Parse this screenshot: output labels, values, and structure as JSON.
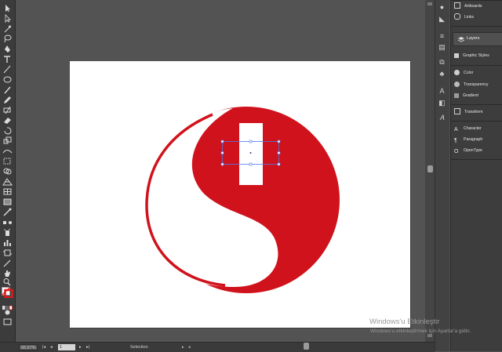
{
  "panels": {
    "items": [
      {
        "label": "Artboards",
        "icon": "artboards-icon"
      },
      {
        "label": "Links",
        "icon": "links-icon"
      },
      {
        "label": "Layers",
        "icon": "layers-icon"
      },
      {
        "label": "Swatches",
        "icon": "swatches-icon"
      },
      {
        "label": "Graphic Styles",
        "icon": "graphic-styles-icon"
      },
      {
        "label": "Color",
        "icon": "color-icon"
      },
      {
        "label": "Transparency",
        "icon": "transparency-icon"
      },
      {
        "label": "Gradient",
        "icon": "gradient-icon"
      },
      {
        "label": "Transform",
        "icon": "transform-icon"
      },
      {
        "label": "Character",
        "icon": "character-icon"
      },
      {
        "label": "Paragraph",
        "icon": "paragraph-icon"
      },
      {
        "label": "OpenType",
        "icon": "opentype-icon"
      }
    ]
  },
  "status": {
    "zoom": "66,67%",
    "page": "1",
    "tool": "Selection"
  },
  "watermark": {
    "line1": "Windows'u Etkinleştir",
    "line2": "Windows'u etkinleştirmek için Ayarlar'a gidin."
  },
  "colors": {
    "accent_red": "#d0121c",
    "selection_blue": "#4f7bf0"
  }
}
